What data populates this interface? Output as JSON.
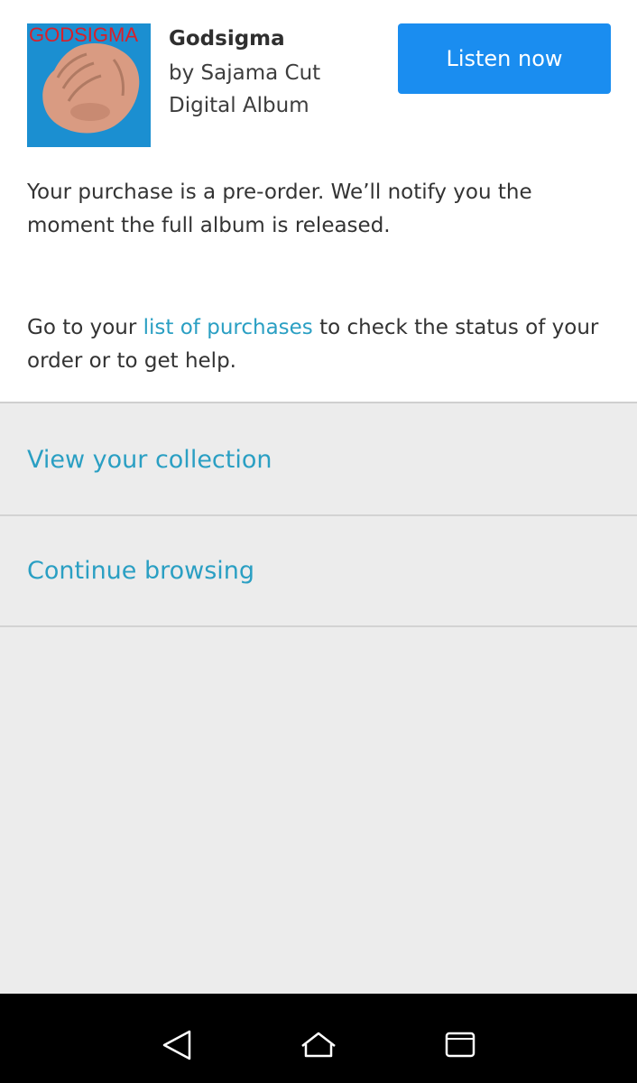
{
  "album": {
    "cover_text": "GODSIGMA",
    "title": "Godsigma",
    "artist": "by Sajama Cut",
    "format": "Digital Album"
  },
  "listen_button": "Listen now",
  "preorder_text": "Your purchase is a pre-order. We’ll notify you the moment the full album is released.",
  "status_text": {
    "before": "Go to your ",
    "link": "list of purchases",
    "after": " to check the status of your order or to get help."
  },
  "actions": {
    "view_collection": "View your collection",
    "continue_browsing": "Continue browsing"
  },
  "nav": {
    "back_icon": "back-triangle-icon",
    "home_icon": "home-icon",
    "recent_icon": "recent-apps-icon"
  },
  "colors": {
    "accent_button": "#1a8df0",
    "link": "#2a9fc3",
    "cover_background": "#1b8fd1",
    "cover_text": "#d8202a"
  }
}
